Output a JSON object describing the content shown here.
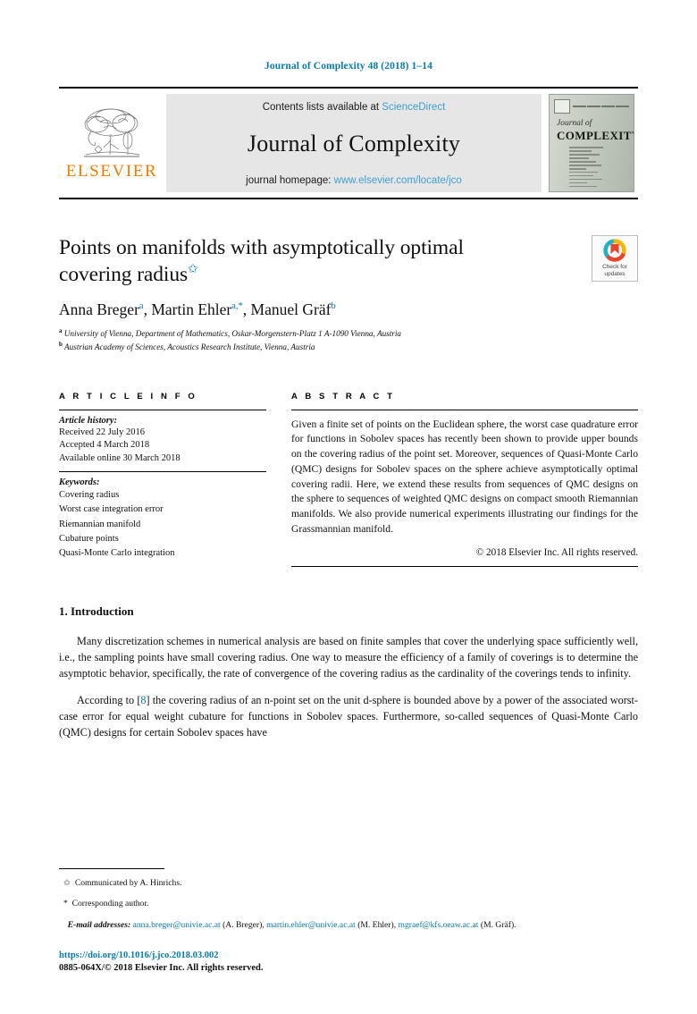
{
  "running_head": "Journal of Complexity 48 (2018) 1–14",
  "masthead": {
    "publisher_logo_text": "ELSEVIER",
    "contents_prefix": "Contents lists available at ",
    "contents_link": "ScienceDirect",
    "journal_title": "Journal of Complexity",
    "homepage_prefix": "journal homepage: ",
    "homepage_link": "www.elsevier.com/locate/jco",
    "cover": {
      "journal_word": "Journal of",
      "complexity_word": "COMPLEXITY"
    }
  },
  "crossmark": {
    "line1": "Check for",
    "line2": "updates"
  },
  "article": {
    "title": "Points on manifolds with asymptotically optimal covering radius",
    "title_footnote_mark": "✩",
    "authors": [
      {
        "name": "Anna Breger",
        "sup": "a"
      },
      {
        "name": "Martin Ehler",
        "sup": "a,*"
      },
      {
        "name": "Manuel Gräf",
        "sup": "b"
      }
    ],
    "affiliations": [
      {
        "mark": "a",
        "text": "University of Vienna, Department of Mathematics, Oskar-Morgenstern-Platz 1 A-1090 Vienna, Austria"
      },
      {
        "mark": "b",
        "text": "Austrian Academy of Sciences, Acoustics Research Institute, Vienna, Austria"
      }
    ]
  },
  "article_info": {
    "heading": "A R T I C L E   I N F O",
    "history_label": "Article history:",
    "history": [
      "Received 22 July 2016",
      "Accepted 4 March 2018",
      "Available online 30 March 2018"
    ],
    "keywords_label": "Keywords:",
    "keywords": [
      "Covering radius",
      "Worst case integration error",
      "Riemannian manifold",
      "Cubature points",
      "Quasi-Monte Carlo integration"
    ]
  },
  "abstract": {
    "heading": "A B S T R A C T",
    "text": "Given a finite set of points on the Euclidean sphere, the worst case quadrature error for functions in Sobolev spaces has recently been shown to provide upper bounds on the covering radius of the point set. Moreover, sequences of Quasi-Monte Carlo (QMC) designs for Sobolev spaces on the sphere achieve asymptotically optimal covering radii. Here, we extend these results from sequences of QMC designs on the sphere to sequences of weighted QMC designs on compact smooth Riemannian manifolds. We also provide numerical experiments illustrating our findings for the Grassmannian manifold.",
    "copyright": "© 2018 Elsevier Inc. All rights reserved."
  },
  "body": {
    "section_number_title": "1. Introduction",
    "paragraph_1": "Many discretization schemes in numerical analysis are based on finite samples that cover the underlying space sufficiently well, i.e., the sampling points have small covering radius. One way to measure the efficiency of a family of coverings is to determine the asymptotic behavior, specifically, the rate of convergence of the covering radius as the cardinality of the coverings tends to infinity.",
    "paragraph_2_before_cite": "According to [",
    "paragraph_2_cite": "8",
    "paragraph_2_after_cite": "] the covering radius of an n-point set on the unit d-sphere is bounded above by a power of the associated worst-case error for equal weight cubature for functions in Sobolev spaces. Furthermore, so-called sequences of Quasi-Monte Carlo (QMC) designs for certain Sobolev spaces have"
  },
  "footnotes": {
    "communicated_mark": "✩",
    "communicated": "Communicated by A. Hinrichs.",
    "corresponding_mark": "*",
    "corresponding": "Corresponding author.",
    "emails_label": "E-mail addresses:",
    "emails": [
      {
        "address": "anna.breger@univie.ac.at",
        "owner": "(A. Breger)"
      },
      {
        "address": "martin.ehler@univie.ac.at",
        "owner": "(M. Ehler)"
      },
      {
        "address": "mgraef@kfs.oeaw.ac.at",
        "owner": "(M. Gräf)"
      }
    ]
  },
  "footer": {
    "doi": "https://doi.org/10.1016/j.jco.2018.03.002",
    "issn_copyright": "0885-064X/© 2018 Elsevier Inc. All rights reserved."
  },
  "colors": {
    "link_teal": "#0a7ba8",
    "link_light_blue": "#3d9fd1",
    "elsevier_orange": "#ef7d00"
  }
}
